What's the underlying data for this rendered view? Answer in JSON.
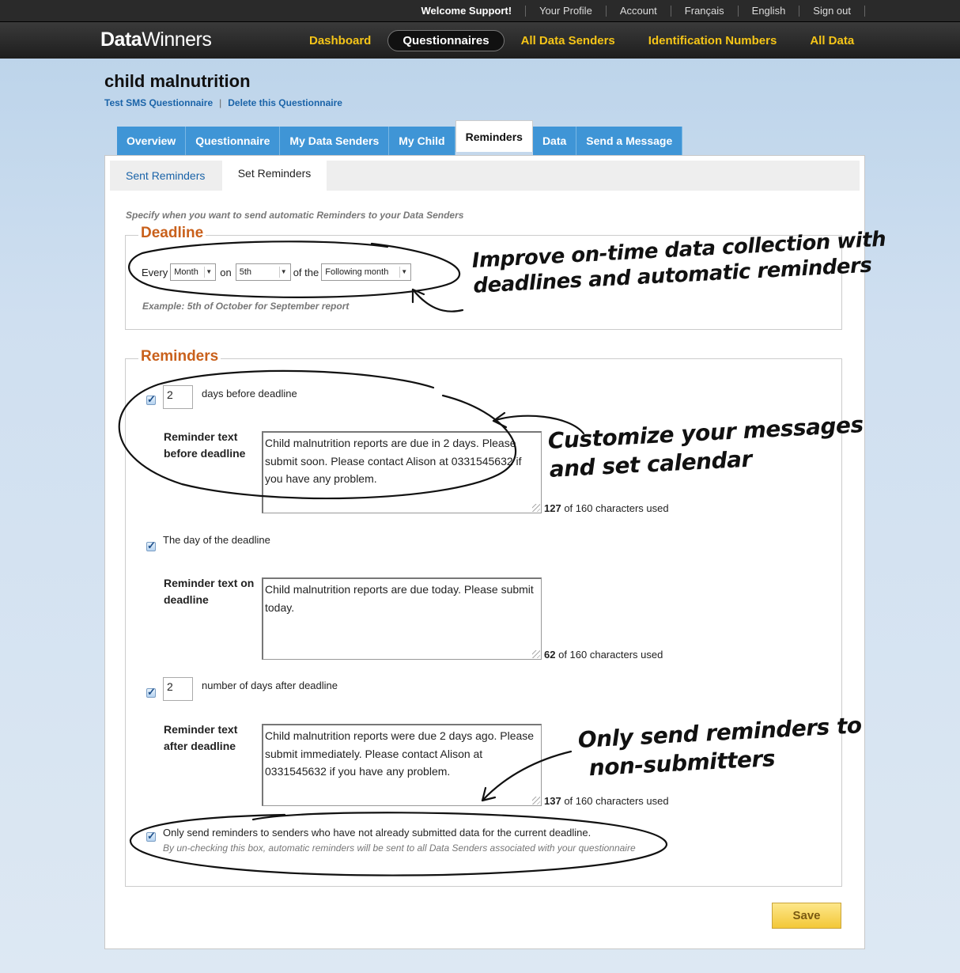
{
  "topbar": {
    "welcome": "Welcome Support!",
    "profile": "Your Profile",
    "account": "Account",
    "lang_fr": "Français",
    "lang_en": "English",
    "signout": "Sign out"
  },
  "brand": {
    "strong": "Data",
    "light": "Winners"
  },
  "nav": [
    "Dashboard",
    "Questionnaires",
    "All Data Senders",
    "Identification Numbers",
    "All Data"
  ],
  "nav_active": "Questionnaires",
  "page": {
    "title": "child malnutrition",
    "test_link": "Test SMS Questionnaire",
    "sep": "|",
    "delete_link": "Delete this Questionnaire"
  },
  "tabs": [
    "Overview",
    "Questionnaire",
    "My Data Senders",
    "My Child",
    "Reminders",
    "Data",
    "Send a Message"
  ],
  "active_tab": "Reminders",
  "subtabs": {
    "sent": "Sent Reminders",
    "set": "Set Reminders"
  },
  "intro": "Specify when you want to send automatic Reminders to your Data Senders",
  "deadline": {
    "legend": "Deadline",
    "every": "Every",
    "frequency": "Month",
    "on": "on",
    "day": "5th",
    "of_the": "of the",
    "period": "Following month",
    "example": "Example: 5th of October for September report"
  },
  "reminders": {
    "legend": "Reminders",
    "before": {
      "checked": true,
      "days": "2",
      "label": "days before deadline",
      "text_label": "Reminder text before deadline",
      "text": "Child malnutrition reports are due in 2 days. Please submit soon. Please contact Alison at 0331545632 if you have any problem.",
      "count": "127",
      "count_suffix": "of 160 characters used"
    },
    "on": {
      "checked": true,
      "label": "The day of the deadline",
      "text_label": "Reminder text on deadline",
      "text": "Child malnutrition reports are due today. Please submit today.",
      "count": "62",
      "count_suffix": "of 160 characters used"
    },
    "after": {
      "checked": true,
      "days": "2",
      "label": "number of days after deadline",
      "text_label": "Reminder text after deadline",
      "text": "Child malnutrition reports were due 2 days ago. Please submit immediately. Please contact Alison at 0331545632 if you have any problem.",
      "count": "137",
      "count_suffix": "of 160 characters used"
    },
    "only_non_submitters": {
      "checked": true,
      "label": "Only send reminders to senders who have not already submitted data for the current deadline.",
      "note": "By un-checking this box, automatic reminders will be sent to all Data Senders associated with your questionnaire"
    }
  },
  "save_label": "Save",
  "annotations": {
    "deadline_line1": "Improve on-time data collection with",
    "deadline_line2": "deadlines and automatic reminders",
    "customize_line1": "Customize your messages",
    "customize_line2": "and set calendar",
    "only_line1": "Only send reminders to",
    "only_line2": "non-submitters"
  }
}
